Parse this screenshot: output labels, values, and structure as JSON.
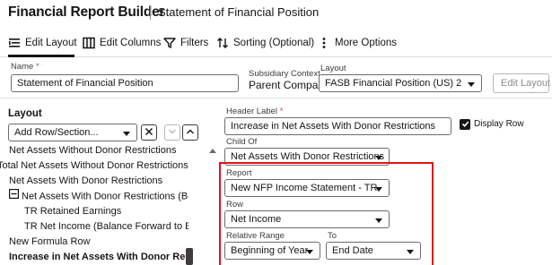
{
  "header": {
    "app_title": "Financial Report Builder",
    "page_title": "Statement of Financial Position"
  },
  "toolbar": {
    "items": [
      {
        "label": "Edit Layout",
        "icon": "edit-layout-icon",
        "active": true
      },
      {
        "label": "Edit Columns",
        "icon": "columns-icon"
      },
      {
        "label": "Filters",
        "icon": "filter-icon"
      },
      {
        "label": "Sorting (Optional)",
        "icon": "sort-icon"
      },
      {
        "label": "More Options",
        "icon": "more-vertical-icon"
      }
    ]
  },
  "form": {
    "name_label": "Name",
    "name_required": "*",
    "name_value": "Statement of Financial Position",
    "subsidiary_label": "Subsidiary Context",
    "subsidiary_value": "Parent Company",
    "layout_label": "Layout",
    "layout_value": "FASB Financial Position (US) 2",
    "edit_layout_button": "Edit Layout"
  },
  "layout_panel": {
    "title": "Layout",
    "add_placeholder": "Add Row/Section...",
    "items": [
      {
        "label": "Net Assets Without Donor Restrictions",
        "bold": false
      },
      {
        "label": "Total Net Assets Without Donor Restrictions",
        "bold": false
      },
      {
        "label": "Net Assets With Donor Restrictions",
        "bold": false
      },
      {
        "label": "Net Assets With Donor Restrictions (Beginning Balance)",
        "bold": false
      },
      {
        "label": "TR Retained Earnings",
        "bold": false
      },
      {
        "label": "TR Net Income (Balance Forward to Beginning)",
        "bold": false
      },
      {
        "label": "New Formula Row",
        "bold": false
      },
      {
        "label": "Increase in Net Assets With Donor Restrictions",
        "bold": true
      }
    ]
  },
  "detail": {
    "header_label_label": "Header Label",
    "header_label_required": "*",
    "header_label_value": "Increase in Net Assets With Donor Restrictions",
    "display_row_label": "Display Row",
    "display_row_checked": true,
    "child_of_label": "Child Of",
    "child_of_value": "Net Assets With Donor Restrictions",
    "report_label": "Report",
    "report_value": "New NFP Income Statement - TR",
    "row_label": "Row",
    "row_value": "Net Income",
    "relative_range_label": "Relative Range",
    "relative_range_value": "Beginning of Year",
    "to_label": "To",
    "to_value": "End Date"
  },
  "colors": {
    "highlight_border": "#e0141c",
    "required": "#c74634",
    "text": "#161513"
  }
}
